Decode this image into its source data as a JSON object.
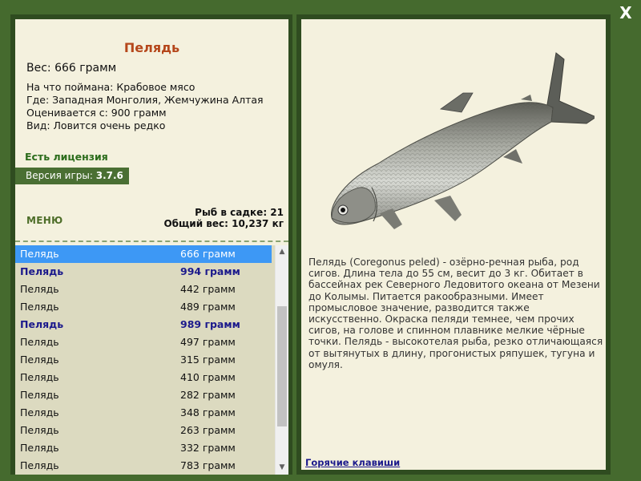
{
  "window": {
    "close_label": "X"
  },
  "fish_info": {
    "title": "Пелядь",
    "weight": "Вес: 666 грамм",
    "caught_on": "На что поймана: Крабовое мясо",
    "location": "Где: Западная Монголия, Жемчужина Алтая",
    "valued_from": "Оценивается с: 900 грамм",
    "rarity": "Вид: Ловится очень редко"
  },
  "license": "Есть лицензия",
  "version": {
    "label": "Версия игры:",
    "value": "3.7.6"
  },
  "menu_label": "МЕНЮ",
  "stats": {
    "fish_in_keepnet": "Рыб в садке: 21",
    "total_weight": "Общий вес: 10,237 кг"
  },
  "fish_list": [
    {
      "name": "Пелядь",
      "weight": "666 грамм",
      "selected": true,
      "heavy": false
    },
    {
      "name": "Пелядь",
      "weight": "994 грамм",
      "selected": false,
      "heavy": true
    },
    {
      "name": "Пелядь",
      "weight": "442 грамм",
      "selected": false,
      "heavy": false
    },
    {
      "name": "Пелядь",
      "weight": "489 грамм",
      "selected": false,
      "heavy": false
    },
    {
      "name": "Пелядь",
      "weight": "989 грамм",
      "selected": false,
      "heavy": true
    },
    {
      "name": "Пелядь",
      "weight": "497 грамм",
      "selected": false,
      "heavy": false
    },
    {
      "name": "Пелядь",
      "weight": "315 грамм",
      "selected": false,
      "heavy": false
    },
    {
      "name": "Пелядь",
      "weight": "410 грамм",
      "selected": false,
      "heavy": false
    },
    {
      "name": "Пелядь",
      "weight": "282 грамм",
      "selected": false,
      "heavy": false
    },
    {
      "name": "Пелядь",
      "weight": "348 грамм",
      "selected": false,
      "heavy": false
    },
    {
      "name": "Пелядь",
      "weight": "263 грамм",
      "selected": false,
      "heavy": false
    },
    {
      "name": "Пелядь",
      "weight": "332 грамм",
      "selected": false,
      "heavy": false
    },
    {
      "name": "Пелядь",
      "weight": "783 грамм",
      "selected": false,
      "heavy": false
    }
  ],
  "scrollbar": {
    "up_icon": "▲",
    "down_icon": "▼"
  },
  "description": "Пелядь (Coregonus peled) - озёрно-речная рыба, род сигов. Длина тела до 55 см, весит до 3 кг. Обитает в бассейнах рек Северного Ледовитого океана от Мезени до Колымы. Питается ракообразными. Имеет промысловое значение, разводится также искусственно. Окраска пеляди темнее, чем прочих сигов, на голове и спинном плавнике мелкие чёрные точки. Пелядь - высокотелая рыба, резко отличающаяся от вытянутых в длину, прогонистых ряпушек, тугуна и омуля.",
  "hotkeys_label": "Горячие клавиши",
  "colors": {
    "frame": "#456a2e",
    "panel": "#f4f1de",
    "list_bg": "#dcdac0",
    "selected_row": "#3d98f5",
    "title": "#b5471b",
    "heavy_row": "#1c1a8c"
  }
}
